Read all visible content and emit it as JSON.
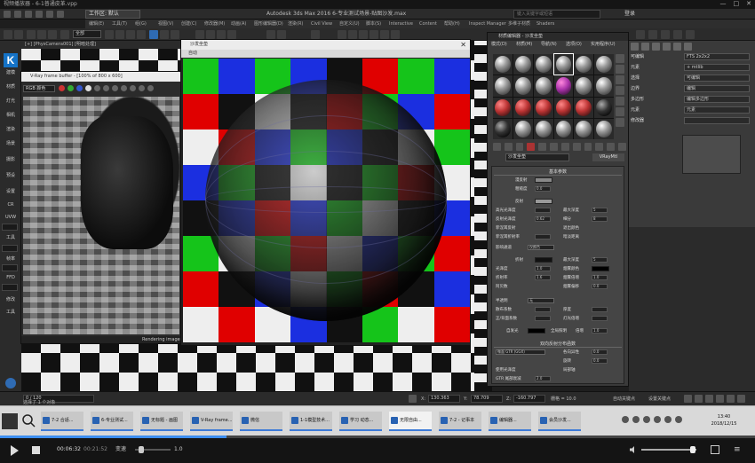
{
  "window": {
    "title": "视频播放器 - 6-1普通皮革.vpp",
    "controls": [
      "—",
      "□",
      "✕"
    ]
  },
  "max": {
    "workspace_label": "工作区: 默认",
    "app_title": "Autodesk 3ds Max 2016    6-专业测试场景-贴图沙发.max",
    "search_placeholder": "键入关键字或短语",
    "login_label": "登录",
    "menus": [
      "编辑(E)",
      "工具(T)",
      "组(G)",
      "视图(V)",
      "创建(C)",
      "修改器(M)",
      "动画(A)",
      "图形编辑器(D)",
      "渲染(R)",
      "Civil View",
      "自定义(U)",
      "脚本(S)",
      "Interactive",
      "Content",
      "帮助(H)",
      "Inspect Manager",
      "多维子材质",
      "Shaders"
    ],
    "selection_filter": "全部"
  },
  "left_strip": {
    "logo": "K",
    "labels": [
      "建模",
      "材质",
      "灯光",
      "相机",
      "渲染",
      "场景",
      "摄影",
      "预设",
      "设置",
      "CR",
      "UVW",
      "工具",
      "帧率",
      "FFD",
      "修改",
      "工具"
    ]
  },
  "viewport": {
    "label": "[+] [PhysCamera001] [明暗处理]"
  },
  "frame_buffer": {
    "title": "V-Ray frame buffer - [100% of 800 x 600]",
    "channel": "RGB 颜色",
    "status": "Rendering image"
  },
  "material_preview": {
    "title": "沙发坐垫",
    "subtitle": "自动",
    "close": "✕",
    "checker_colors": [
      "#e00000",
      "#1b2fe0",
      "#15c41a",
      "#111111",
      "#eeeeee"
    ],
    "grid_pattern": [
      [
        2,
        1,
        2,
        1,
        3,
        0,
        2,
        1
      ],
      [
        0,
        3,
        4,
        3,
        0,
        2,
        1,
        0
      ],
      [
        4,
        0,
        1,
        2,
        1,
        3,
        4,
        2
      ],
      [
        1,
        2,
        3,
        4,
        3,
        2,
        0,
        4
      ],
      [
        3,
        1,
        0,
        1,
        2,
        4,
        3,
        1
      ],
      [
        2,
        4,
        2,
        0,
        4,
        1,
        2,
        0
      ],
      [
        0,
        3,
        1,
        4,
        2,
        0,
        3,
        1
      ],
      [
        4,
        0,
        4,
        1,
        3,
        2,
        4,
        0
      ]
    ]
  },
  "material_editor": {
    "title": "材质编辑器 - 沙发坐垫",
    "menus": [
      "模式(D)",
      "材质(M)",
      "导航(N)",
      "选项(O)",
      "实用程序(U)"
    ],
    "slot_kinds": [
      "white",
      "white",
      "white",
      "white",
      "white",
      "white",
      "white",
      "white",
      "white",
      "purple",
      "white",
      "white",
      "red",
      "red",
      "red",
      "red",
      "red",
      "dark",
      "dark",
      "white",
      "white",
      "white",
      "white",
      "white"
    ],
    "material_name": "沙发坐垫",
    "material_type": "VRayMtl",
    "section_basic": "基本参数",
    "diffuse": "漫反射",
    "roughness": "粗糙度",
    "roughness_val": "0.0",
    "reflect": "反射",
    "hilight_gloss": "高光光泽度",
    "refl_gloss": "反射光泽度",
    "refl_gloss_val": "0.62",
    "fresnel": "菲涅耳反射",
    "fresnel_ior": "菲涅耳折射率",
    "max_depth": "最大深度",
    "max_depth_val": "5",
    "subdivs": "细分",
    "subdivs_val": "8",
    "exit_color": "退出颜色",
    "dim_distance": "暗淡距离",
    "affect_channels": "影响通道",
    "only_color": "仅颜色",
    "refract": "折射",
    "glossiness": "光泽度",
    "glossiness_val": "1.0",
    "ior": "折射率",
    "ior_val": "1.6",
    "abbe": "阿贝数",
    "fog_color": "烟雾颜色",
    "fog_mult": "烟雾倍增",
    "fog_mult_val": "1.0",
    "fog_bias": "烟雾偏移",
    "fog_bias_val": "0.0",
    "translucency": "半透明",
    "none": "无",
    "scatter": "散布系数",
    "fwd_bwd": "正/背面系数",
    "thickness": "厚度",
    "light_mult": "灯光倍增",
    "self_illum": "自发光",
    "gi": "全局照明",
    "mult": "倍增",
    "mult_val": "1.0",
    "section_brdf": "双向反射分布函数",
    "brdf_type": "微面 GTR (GGX)",
    "anisotropy": "各向异性",
    "anisotropy_val": "0.0",
    "rotation": "旋转",
    "rotation_val": "0.0",
    "use_gloss": "使用光泽度",
    "local_axis": "局部轴",
    "tail_falloff": "GTR 尾部衰减",
    "tail_val": "2.0"
  },
  "command_panel": {
    "items": [
      {
        "label": "可编辑",
        "field": "FTS 2x2x2"
      },
      {
        "label": "元素",
        "field": "+ mtlib"
      },
      {
        "label": "选择",
        "field": "可编辑"
      },
      {
        "label": "边界",
        "field": "编辑"
      },
      {
        "label": "多边形",
        "field": "编辑多边形"
      },
      {
        "label": "元素",
        "field": "元素"
      },
      {
        "label": "修改器",
        "field": ""
      }
    ]
  },
  "status_bar": {
    "frame_counter": "0 / 120",
    "selected": "选择了 1 个对象",
    "x_label": "X:",
    "x_val": "130.363",
    "y_label": "Y:",
    "y_val": "78.709",
    "z_label": "Z:",
    "z_val": "-160.797",
    "grid": "栅格 = 10.0",
    "auto_key": "自动关键点",
    "set_key": "设置关键点",
    "time_tag": "添加时间标记"
  },
  "taskbar": {
    "tasks": [
      {
        "label": "7-2 合适...",
        "active": false
      },
      {
        "label": "6-专业测试...",
        "active": false
      },
      {
        "label": "无标题 - 画图",
        "active": false
      },
      {
        "label": "V-Ray frame...",
        "active": false
      },
      {
        "label": "微信",
        "active": false
      },
      {
        "label": "1-1模型技术...",
        "active": false
      },
      {
        "label": "学习 动态...",
        "active": false
      },
      {
        "label": "无限自由...",
        "active": true
      },
      {
        "label": "7-2 - 记事本",
        "active": false
      },
      {
        "label": "编辑器...",
        "active": false
      },
      {
        "label": "会员沙发...",
        "active": false
      }
    ],
    "time": "13:40",
    "date": "2018/12/15"
  },
  "player": {
    "elapsed": "00:06:32",
    "duration": "00:21:52",
    "progress": 0.3,
    "speed_label": "变速",
    "speed_value": "1.0",
    "volume": 0.93,
    "menu_icon": "≡"
  }
}
